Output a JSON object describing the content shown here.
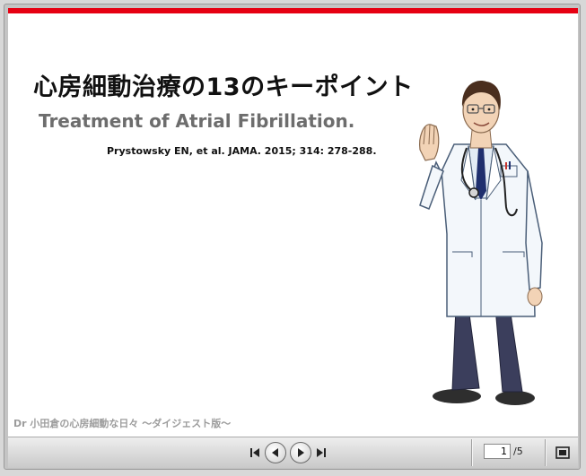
{
  "slide": {
    "title": "心房細動治療の13のキーポイント",
    "subtitle": "Treatment of Atrial Fibrillation.",
    "citation": "Prystowsky EN, et al. JAMA. 2015; 314: 278-288.",
    "footer_caption": "Dr 小田倉の心房細動な日々 ～ダイジェスト版～",
    "accent_color": "#e60012"
  },
  "toolbar": {
    "current_page": "1",
    "total_pages": "/5",
    "icons": [
      "skip-back-icon",
      "previous-icon",
      "play-icon",
      "skip-forward-icon",
      "fullscreen-icon"
    ]
  }
}
